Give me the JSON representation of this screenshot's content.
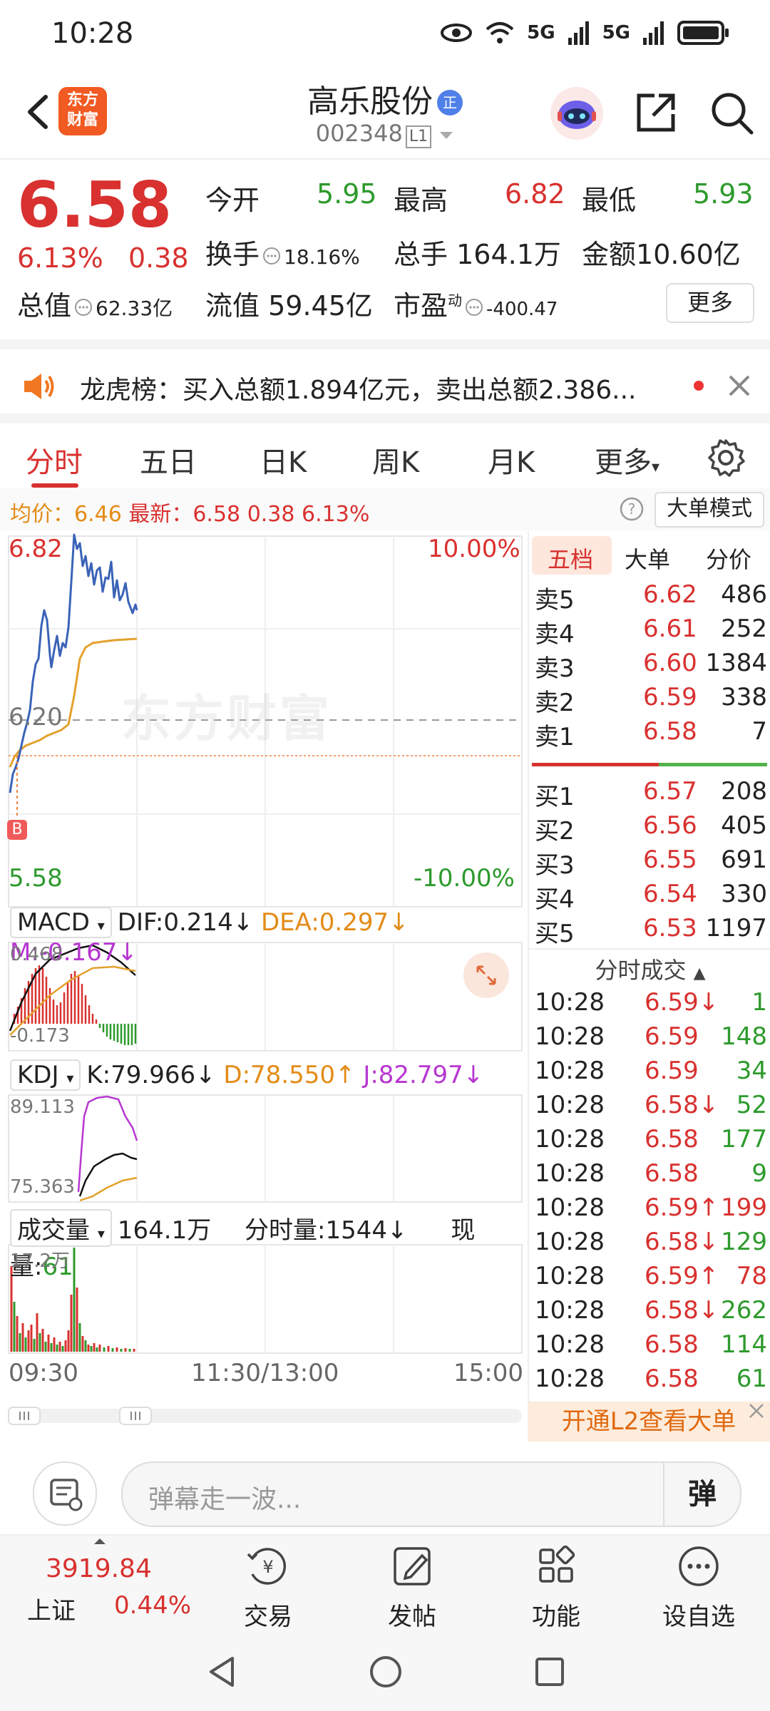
{
  "status": {
    "time": "10:28",
    "net1": "5G",
    "net2": "5G"
  },
  "header": {
    "logo_line1": "东方",
    "logo_line2": "财富",
    "stock_name": "高乐股份",
    "badge": "正",
    "stock_code": "002348",
    "level": "L1"
  },
  "quote": {
    "price": "6.58",
    "change_pct": "6.13%",
    "change": "0.38",
    "open_label": "今开",
    "open": "5.95",
    "high_label": "最高",
    "high": "6.82",
    "low_label": "最低",
    "low": "5.93",
    "turnover_label": "换手",
    "turnover": "18.16%",
    "volume_label": "总手",
    "volume": "164.1万",
    "amount_label": "金额",
    "amount": "10.60亿",
    "mcap_label": "总值",
    "mcap": "62.33亿",
    "float_label": "流值",
    "float": "59.45亿",
    "pe_label": "市盈",
    "pe_sup": "动",
    "pe": "-400.47",
    "more": "更多"
  },
  "ticker": {
    "text": "龙虎榜：买入总额1.894亿元，卖出总额2.386..."
  },
  "tabs": [
    "分时",
    "五日",
    "日K",
    "周K",
    "月K",
    "更多"
  ],
  "avgbar": {
    "avg_label": "均价：",
    "avg": "6.46",
    "latest_label": "最新：",
    "latest": "6.58",
    "chg": "0.38",
    "pct": "6.13%",
    "big_order_mode": "大单模式"
  },
  "intraday": {
    "y_max": "6.82",
    "y_min": "5.58",
    "y_mid": "6.20",
    "pct_max": "10.00%",
    "pct_min": "-10.00%",
    "watermark": "东方财富",
    "buy_marker": "B",
    "x_start": "09:30",
    "x_mid": "11:30/13:00",
    "x_end": "15:00"
  },
  "macd": {
    "name": "MACD",
    "dif": "DIF:0.214↓",
    "dea": "DEA:0.297↓",
    "m": "M:-0.167↓",
    "top": "0.468",
    "bottom": "-0.173"
  },
  "kdj": {
    "name": "KDJ",
    "k": "K:79.966↓",
    "d": "D:78.550↑",
    "j": "J:82.797↓",
    "top": "89.113",
    "bottom": "75.363"
  },
  "vol": {
    "name": "成交量",
    "total": "164.1万",
    "minute_label": "分时量:",
    "minute": "1544↓",
    "now_label": "现量:",
    "now": "61",
    "top": "17.2万"
  },
  "book": {
    "tabs": [
      "五档",
      "大单",
      "分价"
    ],
    "asks": [
      {
        "label": "卖5",
        "price": "6.62",
        "vol": "486"
      },
      {
        "label": "卖4",
        "price": "6.61",
        "vol": "252"
      },
      {
        "label": "卖3",
        "price": "6.60",
        "vol": "1384"
      },
      {
        "label": "卖2",
        "price": "6.59",
        "vol": "338"
      },
      {
        "label": "卖1",
        "price": "6.58",
        "vol": "7"
      }
    ],
    "bids": [
      {
        "label": "买1",
        "price": "6.57",
        "vol": "208"
      },
      {
        "label": "买2",
        "price": "6.56",
        "vol": "405"
      },
      {
        "label": "买3",
        "price": "6.55",
        "vol": "691"
      },
      {
        "label": "买4",
        "price": "6.54",
        "vol": "330"
      },
      {
        "label": "买5",
        "price": "6.53",
        "vol": "1197"
      }
    ],
    "ticks_title": "分时成交",
    "ticks": [
      {
        "t": "10:28",
        "p": "6.59↓",
        "v": "1",
        "dir": "down"
      },
      {
        "t": "10:28",
        "p": "6.59",
        "v": "148",
        "dir": "none"
      },
      {
        "t": "10:28",
        "p": "6.59",
        "v": "34",
        "dir": "none"
      },
      {
        "t": "10:28",
        "p": "6.58↓",
        "v": "52",
        "dir": "down"
      },
      {
        "t": "10:28",
        "p": "6.58",
        "v": "177",
        "dir": "none"
      },
      {
        "t": "10:28",
        "p": "6.58",
        "v": "9",
        "dir": "none"
      },
      {
        "t": "10:28",
        "p": "6.59↑",
        "v": "199",
        "dir": "up"
      },
      {
        "t": "10:28",
        "p": "6.58↓",
        "v": "129",
        "dir": "down"
      },
      {
        "t": "10:28",
        "p": "6.59↑",
        "v": "78",
        "dir": "up"
      },
      {
        "t": "10:28",
        "p": "6.58↓",
        "v": "262",
        "dir": "down"
      },
      {
        "t": "10:28",
        "p": "6.58",
        "v": "114",
        "dir": "none"
      },
      {
        "t": "10:28",
        "p": "6.58",
        "v": "61",
        "dir": "none"
      }
    ],
    "l2_promo": "开通L2查看大单"
  },
  "comment": {
    "placeholder": "弹幕走一波...",
    "dan": "弹"
  },
  "bottom": {
    "index_value": "3919.84",
    "index_name": "上证",
    "index_pct": "0.44%",
    "nav": [
      "交易",
      "发帖",
      "功能",
      "设自选"
    ]
  },
  "colors": {
    "up": "#d8312f",
    "down": "#2d9a2d",
    "avg": "#e3a12c",
    "price_line": "#3a63b8"
  }
}
